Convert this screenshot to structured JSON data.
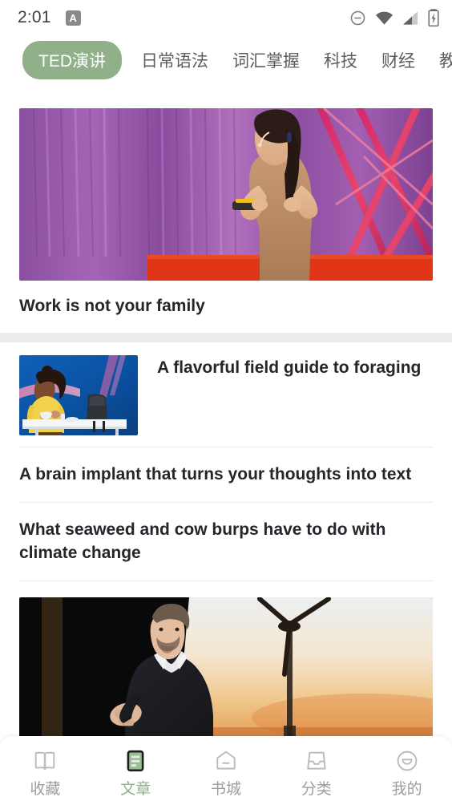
{
  "status_bar": {
    "time": "2:01",
    "app_icon_letter": "A",
    "icons": [
      "do-not-disturb-icon",
      "wifi-icon",
      "cell-signal-icon",
      "battery-charging-icon"
    ]
  },
  "category_tabs": {
    "active_index": 0,
    "active_color": "#8fb089",
    "items": [
      {
        "label": "TED演讲",
        "active": true
      },
      {
        "label": "日常语法",
        "active": false
      },
      {
        "label": "词汇掌握",
        "active": false
      },
      {
        "label": "科技",
        "active": false
      },
      {
        "label": "财经",
        "active": false
      },
      {
        "label": "教",
        "active": false
      }
    ]
  },
  "feed": {
    "items": [
      {
        "layout": "hero",
        "title": "Work is not your family",
        "image": "ted-speaker-purple-stage"
      },
      {
        "layout": "thumb-left",
        "title": "A flavorful field guide to foraging",
        "image": "ted-speaker-yellow-top-blue-stage"
      },
      {
        "layout": "text-only",
        "title": "A brain implant that turns your thoughts into text"
      },
      {
        "layout": "text-only",
        "title": "What seaweed and cow burps have to do with climate change"
      },
      {
        "layout": "wide-image",
        "image": "ted-speaker-suit-wind-turbine"
      }
    ]
  },
  "bottom_nav": {
    "active_index": 1,
    "active_color": "#8fb089",
    "inactive_color": "#9e9e9e",
    "items": [
      {
        "label": "收藏",
        "icon": "open-book-icon",
        "active": false
      },
      {
        "label": "文章",
        "icon": "article-document-icon",
        "active": true
      },
      {
        "label": "书城",
        "icon": "bookstore-house-icon",
        "active": false
      },
      {
        "label": "分类",
        "icon": "category-tray-icon",
        "active": false
      },
      {
        "label": "我的",
        "icon": "profile-smiley-icon",
        "active": false
      }
    ]
  }
}
